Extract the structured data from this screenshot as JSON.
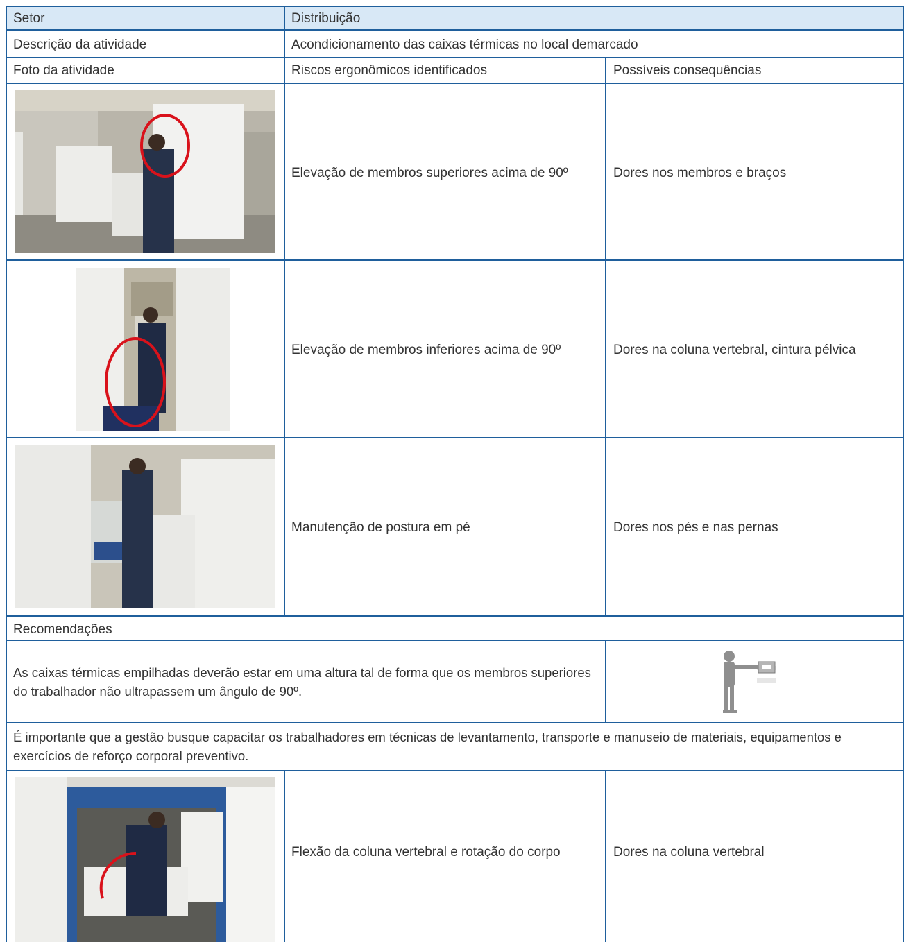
{
  "header": {
    "setor_label": "Setor",
    "setor_value": "Distribuição",
    "descricao_label": "Descrição da atividade",
    "descricao_value": "Acondicionamento das caixas térmicas no local demarcado",
    "foto_header": "Foto da atividade",
    "riscos_header": "Riscos ergonômicos identificados",
    "consequencias_header": "Possíveis consequências"
  },
  "rows": [
    {
      "photo": "worker-arms-raised-stacking-boxes",
      "risco": "Elevação de membros superiores acima de 90º",
      "consequencia": "Dores nos membros e braços"
    },
    {
      "photo": "worker-leg-raised-climbing-boxes",
      "risco": "Elevação de membros inferiores acima de 90º",
      "consequencia": "Dores na coluna vertebral, cintura pélvica"
    },
    {
      "photo": "worker-standing-between-boxes",
      "risco": "Manutenção de postura em pé",
      "consequencia": "Dores nos pés e nas pernas"
    }
  ],
  "recomendacoes": {
    "title": "Recomendações",
    "text1": "As caixas térmicas empilhadas deverão estar em uma altura tal de forma que os membros superiores do trabalhador não ultrapassem um ângulo de 90º.",
    "pictogram": "person-holding-box-at-90-degrees",
    "text2": "É importante que a gestão busque capacitar os trabalhadores em técnicas de levantamento, transporte e manuseio de materiais, equipamentos e exercícios de reforço corporal preventivo."
  },
  "last_row": {
    "photo": "worker-bending-in-freight-elevator",
    "risco": "Flexão da coluna vertebral e rotação do corpo",
    "consequencia": "Dores na coluna vertebral"
  },
  "colors": {
    "border": "#1f5f9c",
    "header_fill": "#d8e8f6",
    "highlight_circle": "#d9121b",
    "text": "#333333"
  }
}
